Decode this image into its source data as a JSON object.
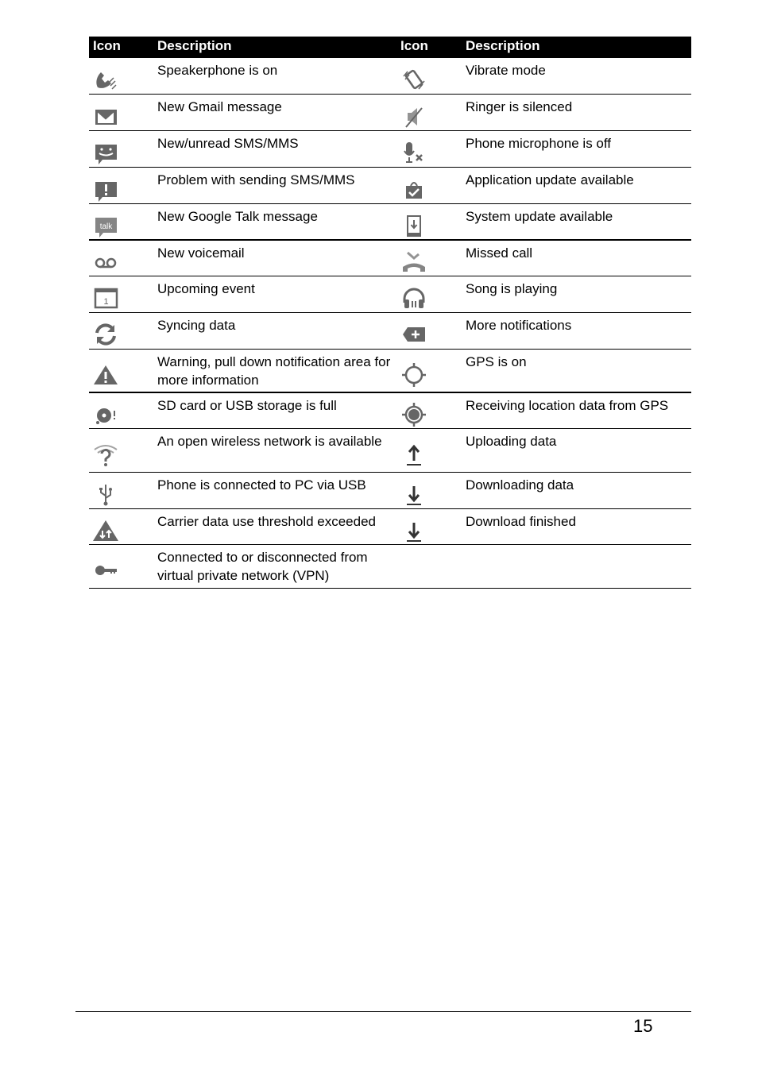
{
  "header": {
    "icon_col": "Icon",
    "desc_col": "Description",
    "icon_col2": "Icon",
    "desc_col2": "Description"
  },
  "rows": [
    {
      "left": {
        "icon": "speakerphone-icon",
        "text": "Speakerphone is on"
      },
      "right": {
        "icon": "vibrate-icon",
        "text": "Vibrate mode"
      }
    },
    {
      "left": {
        "icon": "gmail-icon",
        "text": "New Gmail message"
      },
      "right": {
        "icon": "ringer-silenced-icon",
        "text": "Ringer is silenced"
      }
    },
    {
      "left": {
        "icon": "sms-icon",
        "text": "New/unread SMS/MMS"
      },
      "right": {
        "icon": "mic-off-icon",
        "text": "Phone microphone is off"
      }
    },
    {
      "left": {
        "icon": "sms-problem-icon",
        "text": "Problem with sending SMS/MMS"
      },
      "right": {
        "icon": "app-update-icon",
        "text": "Application update available"
      }
    },
    {
      "left": {
        "icon": "talk-icon",
        "text": "New Google Talk message"
      },
      "right": {
        "icon": "system-update-icon",
        "text": "System update available"
      }
    },
    {
      "left": {
        "icon": "voicemail-icon",
        "text": "New voicemail"
      },
      "right": {
        "icon": "missed-call-icon",
        "text": "Missed call"
      }
    },
    {
      "left": {
        "icon": "calendar-icon",
        "text": "Upcoming event"
      },
      "right": {
        "icon": "headphones-icon",
        "text": "Song is playing"
      }
    },
    {
      "left": {
        "icon": "sync-icon",
        "text": "Syncing data"
      },
      "right": {
        "icon": "more-notifications-icon",
        "text": "More notifications"
      }
    },
    {
      "left": {
        "icon": "warning-icon",
        "text": "Warning, pull down notification area for more information"
      },
      "right": {
        "icon": "gps-on-icon",
        "text": "GPS is on"
      }
    },
    {
      "left": {
        "icon": "storage-full-icon",
        "text": "SD card or USB storage is full"
      },
      "right": {
        "icon": "gps-receiving-icon",
        "text": "Receiving location data from GPS"
      }
    },
    {
      "left": {
        "icon": "open-wifi-icon",
        "text": "An open wireless network is available"
      },
      "right": {
        "icon": "upload-icon",
        "text": "Uploading data"
      }
    },
    {
      "left": {
        "icon": "usb-icon",
        "text": "Phone is connected to PC via USB"
      },
      "right": {
        "icon": "download-icon",
        "text": "Downloading data"
      }
    },
    {
      "left": {
        "icon": "data-warning-icon",
        "text": "Carrier data use threshold exceeded"
      },
      "right": {
        "icon": "download-finished-icon",
        "text": "Download finished"
      }
    },
    {
      "left": {
        "icon": "vpn-key-icon",
        "text": "Connected to or disconnected from virtual private network (VPN)"
      },
      "right": null
    }
  ],
  "page_number": "15",
  "colors": {
    "icon_gray": "#666666",
    "header_bg": "#000000"
  }
}
